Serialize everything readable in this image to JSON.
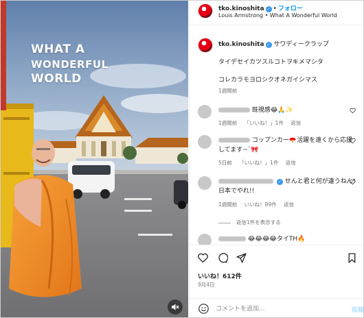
{
  "video": {
    "overlay": [
      "WHAT A",
      "WONDERFUL",
      "WORLD"
    ],
    "mute_icon": "speaker-muted-icon"
  },
  "header": {
    "username": "tko.kinoshita",
    "separator": "•",
    "follow_label": "フォロー",
    "music": "Louis Armstrong • What A Wonderful World"
  },
  "caption": {
    "username": "tko.kinoshita",
    "line1": "サワディークラップ",
    "line2": "タイデセイカツスルコトヲキメマシタ",
    "line3": "コレカラモヨロシクオネガイシマス",
    "time": "1週間前"
  },
  "comments": [
    {
      "text": "既視感😂🙏✨",
      "meta": [
        "1週間前",
        "「いいね！」1件",
        "返信"
      ]
    },
    {
      "text": "コップンカー🪭活躍を遠くから応援してます~`🎀",
      "meta": [
        "5日前",
        "「いいね！」1件",
        "返信"
      ]
    },
    {
      "text": "せんと君と何が違うねん!日本でやれ!!",
      "meta": [
        "1週間前",
        "いいね！89件",
        "返信"
      ]
    },
    {
      "text": "😂😂😂😂タイTH🔥",
      "meta": []
    }
  ],
  "replies_label": "返信1件を表示する",
  "actions": {
    "icons": [
      "heart-icon",
      "comment-icon",
      "share-icon",
      "bookmark-icon"
    ],
    "likes": "いいね！612件",
    "date": "9月4日"
  },
  "composer": {
    "placeholder": "コメントを追加...",
    "post_label": "投稿"
  },
  "colors": {
    "accent": "#0095f6",
    "verified": "#3897f0",
    "robe": "#f28a1e",
    "secondary_text": "#737373"
  }
}
